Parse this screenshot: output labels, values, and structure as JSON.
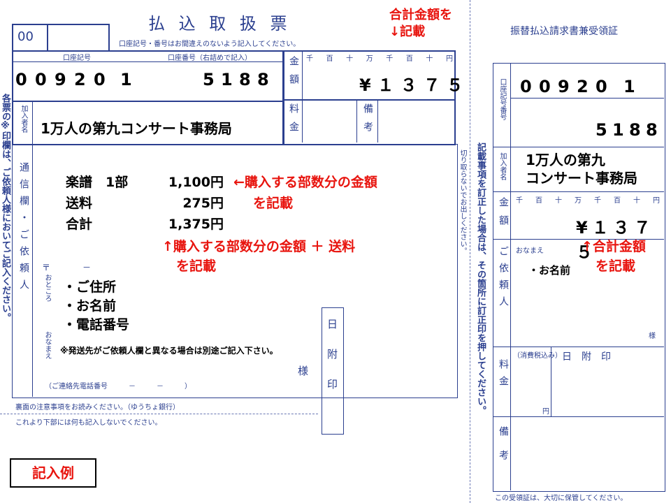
{
  "main": {
    "title": "払 込 取 扱 票",
    "code_box": "00",
    "subtitle": "口座記号・番号はお間違えのないよう記入してください。",
    "account_symbol_label": "口座記号",
    "account_number_label": "口座番号（右詰めで記入）",
    "account_symbol_digits": [
      "0",
      "0",
      "9",
      "2",
      "0"
    ],
    "account_symbol_extra": "1",
    "account_number_digits": [
      "5",
      "1",
      "8",
      "8"
    ],
    "subscriber_label": "加入者名",
    "subscriber_name": "1万人の第九コンサート事務局",
    "amount_label": "金額",
    "fee_label": "料金",
    "remarks_label": "備考",
    "units": [
      "千",
      "百",
      "十",
      "万",
      "千",
      "百",
      "十",
      "円"
    ],
    "amount_value": "¥１３７５",
    "message_label": "通信欄・ご依頼人",
    "items": [
      {
        "name": "楽譜　1部",
        "price": "1,100円"
      },
      {
        "name": "送料",
        "price": "275円"
      },
      {
        "name": "合計",
        "price": "1,375円"
      }
    ],
    "postal_mark": "〒",
    "postal_dash": "－",
    "address_label": "おところ",
    "name_label": "おなまえ",
    "bullets": [
      "・ご住所",
      "・お名前",
      "・電話番号"
    ],
    "note_shipping": "※発送先がご依頼人欄と異なる場合は別途ご記入下さい。",
    "sama": "様",
    "phone_label": "（ご連絡先電話番号　　　－　　　－　　　）",
    "date_stamp": "日附印",
    "footer1": "裏面の注意事項をお読みください。（ゆうちょ銀行）",
    "footer2": "これより下部には何も記入しないでください。",
    "left_side_note": "各票の※印欄は、ご依頼人様においてご記入ください。",
    "center_note": "切り取らないでお出しください。",
    "correction_note": "記載事項を訂正した場合は、その箇所に訂正印を押してください。"
  },
  "annotations": {
    "top_total": "合計金額を\n↓記載",
    "per_copy": "←購入する部数分の金額",
    "per_copy_2": "を記載",
    "plus_shipping": "↑購入する部数分の金額 ＋ 送料",
    "plus_shipping_2": "を記載",
    "receipt_total": "↑合計金額",
    "receipt_total_2": "を記載",
    "example_badge": "記入例"
  },
  "receipt": {
    "title": "振替払込請求書兼受領証",
    "account_label": "口座記号番号",
    "account_symbol_digits": [
      "0",
      "0",
      "9",
      "2",
      "0"
    ],
    "account_symbol_extra": "1",
    "account_number_digits": [
      "5",
      "1",
      "8",
      "8"
    ],
    "subscriber_label": "加入者名",
    "subscriber_line1": "1万人の第九",
    "subscriber_line2": "コンサート事務局",
    "amount_label": "金額",
    "units": [
      "千",
      "百",
      "十",
      "万",
      "千",
      "百",
      "十",
      "円"
    ],
    "amount_value": "¥１３７５",
    "requester_label": "ご依頼人",
    "name_label": "おなまえ",
    "name_value": "・お名前",
    "sama": "様",
    "fee_label": "料金",
    "tax_label": "（消費税込み）",
    "yen": "円",
    "date_stamp": "日　附　印",
    "remarks_label": "備考",
    "footer": "この受領証は、大切に保管してください。"
  },
  "colors": {
    "form_blue": "#2b3f8f",
    "annotation_red": "#e8140e"
  }
}
